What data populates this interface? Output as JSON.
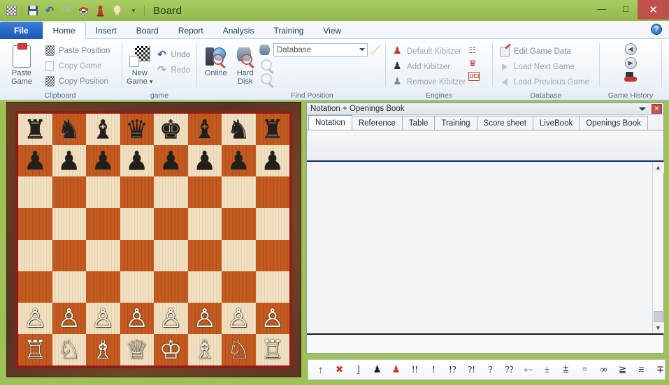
{
  "window": {
    "title": "Board",
    "quick_access": [
      {
        "name": "board-icon",
        "label": "Board"
      },
      {
        "name": "save-icon",
        "label": "Save"
      },
      {
        "name": "undo-icon",
        "label": "Undo"
      },
      {
        "name": "redo-icon",
        "label": "Redo"
      },
      {
        "name": "chess-clown-icon",
        "label": "Fritz"
      },
      {
        "name": "red-pawn-icon",
        "label": "Piece"
      },
      {
        "name": "lightbulb-icon",
        "label": "Hint"
      },
      {
        "name": "customize-dropdown-icon",
        "label": "Customize"
      }
    ],
    "controls": {
      "minimize": "—",
      "maximize": "□",
      "close": "✕"
    },
    "accent_green": "#9cc255",
    "close_red": "#c0504d"
  },
  "ribbon": {
    "tabs": [
      {
        "label": "File",
        "active": false,
        "file": true
      },
      {
        "label": "Home",
        "active": true
      },
      {
        "label": "Insert",
        "active": false
      },
      {
        "label": "Board",
        "active": false
      },
      {
        "label": "Report",
        "active": false
      },
      {
        "label": "Analysis",
        "active": false
      },
      {
        "label": "Training",
        "active": false
      },
      {
        "label": "View",
        "active": false
      }
    ],
    "help_label": "?",
    "groups": [
      {
        "name": "clipboard",
        "label": "Clipboard",
        "big_button": {
          "label_line1": "Paste",
          "label_line2": "Game",
          "icon": "clipboard-icon"
        },
        "items": [
          {
            "label": "Paste Position",
            "icon": "paste-position-icon"
          },
          {
            "label": "Copy Game",
            "icon": "copy-game-icon"
          },
          {
            "label": "Copy Position",
            "icon": "copy-position-icon"
          }
        ]
      },
      {
        "name": "game",
        "label": "game",
        "big_button": {
          "label_line1": "New",
          "label_line2": "Game",
          "icon": "new-game-icon",
          "has_dropdown": true
        },
        "items": [
          {
            "label": "Undo",
            "icon": "undo-arrow-icon"
          },
          {
            "label": "Redo",
            "icon": "redo-arrow-icon"
          }
        ]
      },
      {
        "name": "find-position",
        "label": "Find Position",
        "big_buttons": [
          {
            "label": "Online",
            "icon": "online-search-icon"
          },
          {
            "label_line1": "Hard",
            "label_line2": "Disk",
            "icon": "hard-disk-search-icon"
          }
        ],
        "combo": {
          "value": "Database",
          "icon": "database-icon"
        },
        "extra_icons": [
          "search-variant-1-icon",
          "search-variant-2-icon",
          "search-broom-icon"
        ]
      },
      {
        "name": "engines",
        "label": "Engines",
        "items": [
          {
            "label": "Default Kibitzer",
            "icon": "default-kibitzer-icon"
          },
          {
            "label": "Add Kibitzer",
            "icon": "add-kibitzer-icon"
          },
          {
            "label": "Remove Kibitzer",
            "icon": "remove-kibitzer-icon"
          }
        ],
        "side_icons": [
          "engine-list-icon",
          "engine-machine-icon",
          "uci-icon"
        ]
      },
      {
        "name": "database",
        "label": "Database",
        "items": [
          {
            "label": "Edit Game Data",
            "icon": "edit-game-data-icon"
          },
          {
            "label": "Load Next Game",
            "icon": "next-game-icon"
          },
          {
            "label": "Load Previous Game",
            "icon": "previous-game-icon"
          }
        ]
      },
      {
        "name": "game-history",
        "label": "Game History",
        "icons": [
          "history-back-icon",
          "history-forward-icon",
          "history-hat-icon"
        ]
      }
    ]
  },
  "board": {
    "light_square_color": "#f0dfc0",
    "dark_square_color": "#c45a1f",
    "frame_color": "#5a3120",
    "border_color": "#8e1f18",
    "position_name": "starting-position",
    "ranks": [
      [
        "♜",
        "♞",
        "♝",
        "♛",
        "♚",
        "♝",
        "♞",
        "♜"
      ],
      [
        "♟",
        "♟",
        "♟",
        "♟",
        "♟",
        "♟",
        "♟",
        "♟"
      ],
      [
        "",
        "",
        "",
        "",
        "",
        "",
        "",
        ""
      ],
      [
        "",
        "",
        "",
        "",
        "",
        "",
        "",
        ""
      ],
      [
        "",
        "",
        "",
        "",
        "",
        "",
        "",
        ""
      ],
      [
        "",
        "",
        "",
        "",
        "",
        "",
        "",
        ""
      ],
      [
        "♙",
        "♙",
        "♙",
        "♙",
        "♙",
        "♙",
        "♙",
        "♙"
      ],
      [
        "♖",
        "♘",
        "♗",
        "♕",
        "♔",
        "♗",
        "♘",
        "♖"
      ]
    ],
    "rank_colors": [
      [
        "b",
        "b",
        "b",
        "b",
        "b",
        "b",
        "b",
        "b"
      ],
      [
        "b",
        "b",
        "b",
        "b",
        "b",
        "b",
        "b",
        "b"
      ],
      [
        "",
        "",
        "",
        "",
        "",
        "",
        "",
        ""
      ],
      [
        "",
        "",
        "",
        "",
        "",
        "",
        "",
        ""
      ],
      [
        "",
        "",
        "",
        "",
        "",
        "",
        "",
        ""
      ],
      [
        "",
        "",
        "",
        "",
        "",
        "",
        "",
        ""
      ],
      [
        "w",
        "w",
        "w",
        "w",
        "w",
        "w",
        "w",
        "w"
      ],
      [
        "w",
        "w",
        "w",
        "w",
        "w",
        "w",
        "w",
        "w"
      ]
    ]
  },
  "notation_panel": {
    "title": "Notation + Openings Book",
    "collapse_icon": "chevron-down-icon",
    "close_label": "✕",
    "tabs": [
      {
        "label": "Notation",
        "active": true
      },
      {
        "label": "Reference",
        "active": false
      },
      {
        "label": "Table",
        "active": false
      },
      {
        "label": "Training",
        "active": false
      },
      {
        "label": "Score sheet",
        "active": false
      },
      {
        "label": "LiveBook",
        "active": false
      },
      {
        "label": "Openings Book",
        "active": false
      }
    ],
    "content": "",
    "scrollbar": {
      "up": "▲",
      "down": "▼"
    }
  },
  "annotation_toolbar": {
    "buttons": [
      {
        "symbol": "↑",
        "name": "attack-arrow-button",
        "style": "green"
      },
      {
        "symbol": "✖",
        "name": "delete-move-button",
        "style": "red"
      },
      {
        "symbol": "]",
        "name": "bracket-button",
        "style": "dark"
      },
      {
        "symbol": "♟",
        "name": "black-pawn-button",
        "style": "dark"
      },
      {
        "symbol": "♟",
        "name": "red-pawn-button",
        "style": "red"
      },
      {
        "symbol": "!!",
        "name": "brilliant-move-button",
        "style": "dark"
      },
      {
        "symbol": "!",
        "name": "good-move-button",
        "style": "dark"
      },
      {
        "symbol": "!?",
        "name": "interesting-move-button",
        "style": "dark"
      },
      {
        "symbol": "?!",
        "name": "dubious-move-button",
        "style": "dark"
      },
      {
        "symbol": "?",
        "name": "mistake-button",
        "style": "dark"
      },
      {
        "symbol": "??",
        "name": "blunder-button",
        "style": "dark"
      },
      {
        "symbol": "+−",
        "name": "white-winning-button",
        "style": "dark small"
      },
      {
        "symbol": "±",
        "name": "white-clear-advantage-button",
        "style": "dark"
      },
      {
        "symbol": "⩲",
        "name": "white-slight-advantage-button",
        "style": "dark"
      },
      {
        "symbol": "=",
        "name": "equal-position-button",
        "style": "dark"
      },
      {
        "symbol": "∞",
        "name": "unclear-position-button",
        "style": "dark"
      },
      {
        "symbol": "≧",
        "name": "compensation-button",
        "style": "dark"
      },
      {
        "symbol": "⩳",
        "name": "black-slight-advantage-button",
        "style": "dark"
      },
      {
        "symbol": "∓",
        "name": "black-clear-advantage-button",
        "style": "dark"
      }
    ]
  }
}
